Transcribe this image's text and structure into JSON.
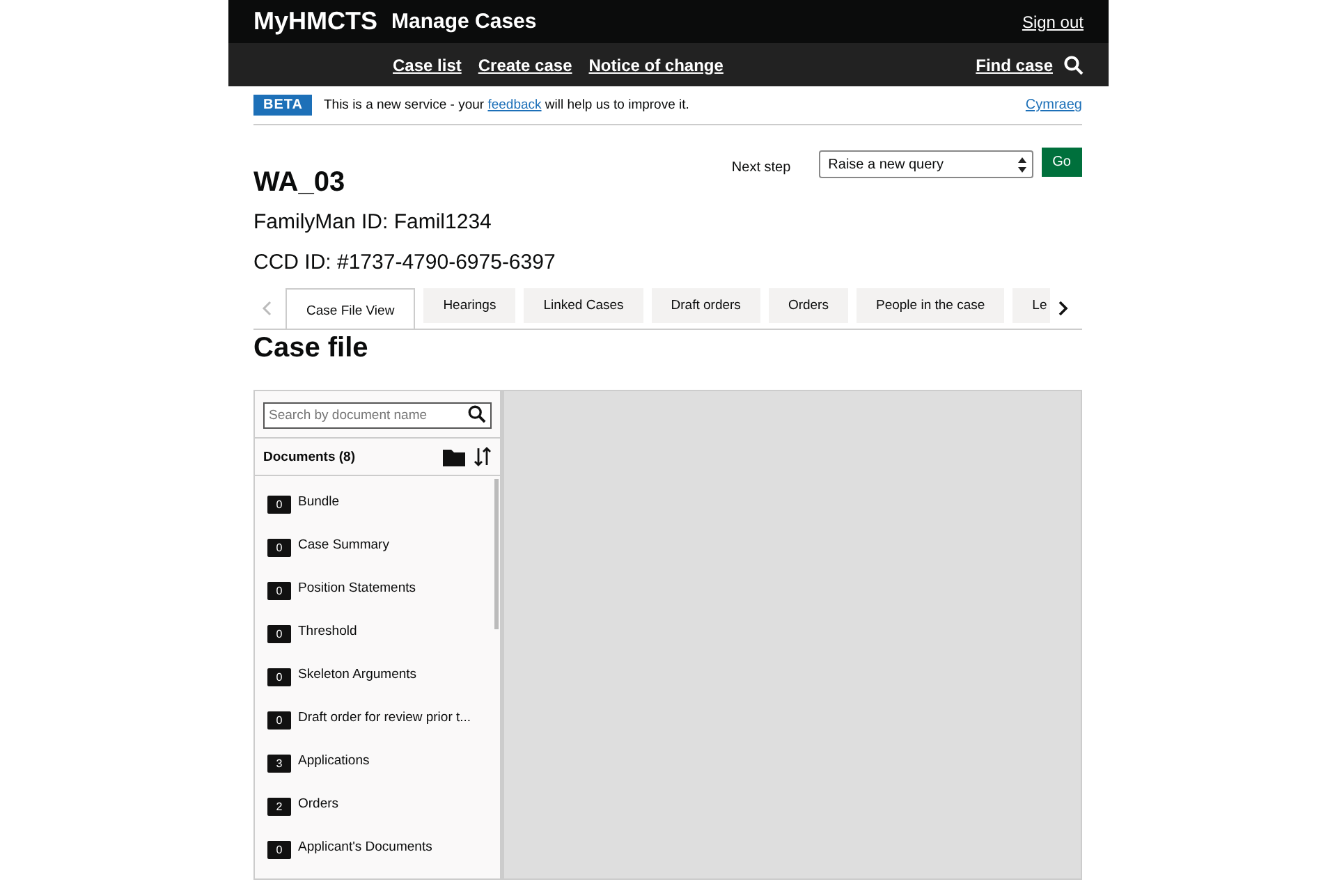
{
  "header": {
    "logo": "MyHMCTS",
    "service": "Manage Cases",
    "sign_out": "Sign out"
  },
  "nav": {
    "links": [
      "Case list",
      "Create case",
      "Notice of change"
    ],
    "find_case": "Find case"
  },
  "banner": {
    "tag": "BETA",
    "text_before": "This is a new service - your ",
    "link": "feedback",
    "text_after": " will help us to improve it.",
    "language": "Cymraeg"
  },
  "case": {
    "title": "WA_03",
    "familyman_id": "FamilyMan ID: Famil1234",
    "ccd_id": "CCD ID: #1737-4790-6975-6397"
  },
  "next_step": {
    "label": "Next step",
    "value": "Raise a new query",
    "button": "Go"
  },
  "tabs": [
    {
      "label": "Case File View",
      "selected": true
    },
    {
      "label": "Hearings",
      "selected": false
    },
    {
      "label": "Linked Cases",
      "selected": false
    },
    {
      "label": "Draft orders",
      "selected": false
    },
    {
      "label": "Orders",
      "selected": false
    },
    {
      "label": "People in the case",
      "selected": false
    },
    {
      "label": "Le",
      "selected": false
    }
  ],
  "section_title": "Case file",
  "documents": {
    "search_placeholder": "Search by document name",
    "heading": "Documents (8)",
    "folders": [
      {
        "count": "0",
        "name": "Bundle"
      },
      {
        "count": "0",
        "name": "Case Summary"
      },
      {
        "count": "0",
        "name": "Position Statements"
      },
      {
        "count": "0",
        "name": "Threshold"
      },
      {
        "count": "0",
        "name": "Skeleton Arguments"
      },
      {
        "count": "0",
        "name": "Draft order for review prior t..."
      },
      {
        "count": "3",
        "name": "Applications"
      },
      {
        "count": "2",
        "name": "Orders"
      },
      {
        "count": "0",
        "name": "Applicant's Documents"
      }
    ]
  }
}
